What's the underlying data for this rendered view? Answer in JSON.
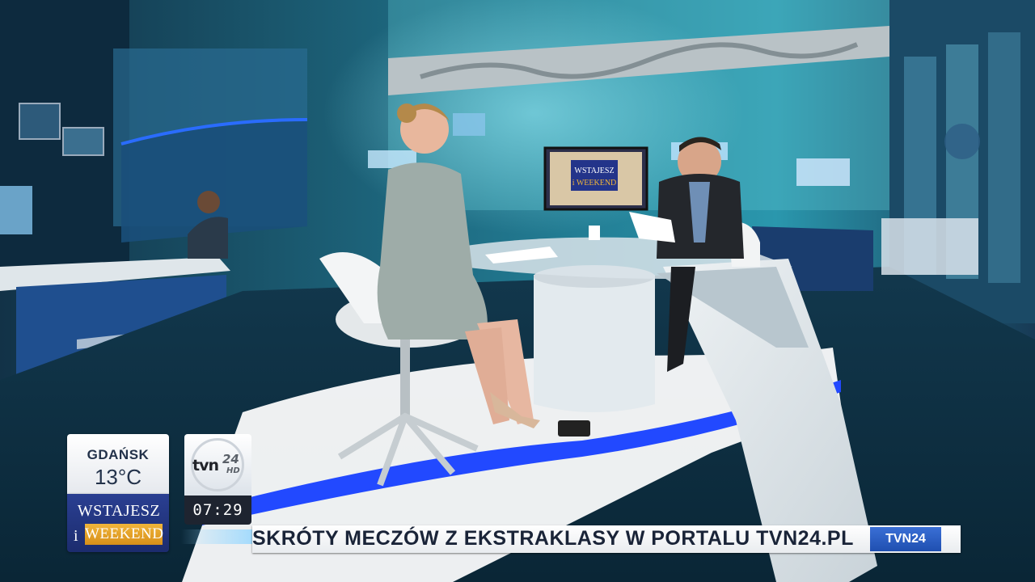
{
  "weather": {
    "city": "GDAŃSK",
    "temperature": "13°C"
  },
  "show_logo": {
    "line1": "WSTAJESZ",
    "line2": "i",
    "line3": "WEEKEND"
  },
  "monitor_logo": {
    "line1": "WSTAJESZ",
    "line2": "i WEEKEND"
  },
  "channel": {
    "name": "tvn",
    "number": "24",
    "badge": "HD"
  },
  "clock": "07:29",
  "ticker": {
    "headline": "SKRÓTY MECZÓW Z EKSTRAKLASY W PORTALU TVN24.PL",
    "tag": "TVN24"
  },
  "colors": {
    "studio_blue": "#1f5fff",
    "ticker_tag": "#2b5fc8",
    "show_gold": "#e3a02a"
  }
}
